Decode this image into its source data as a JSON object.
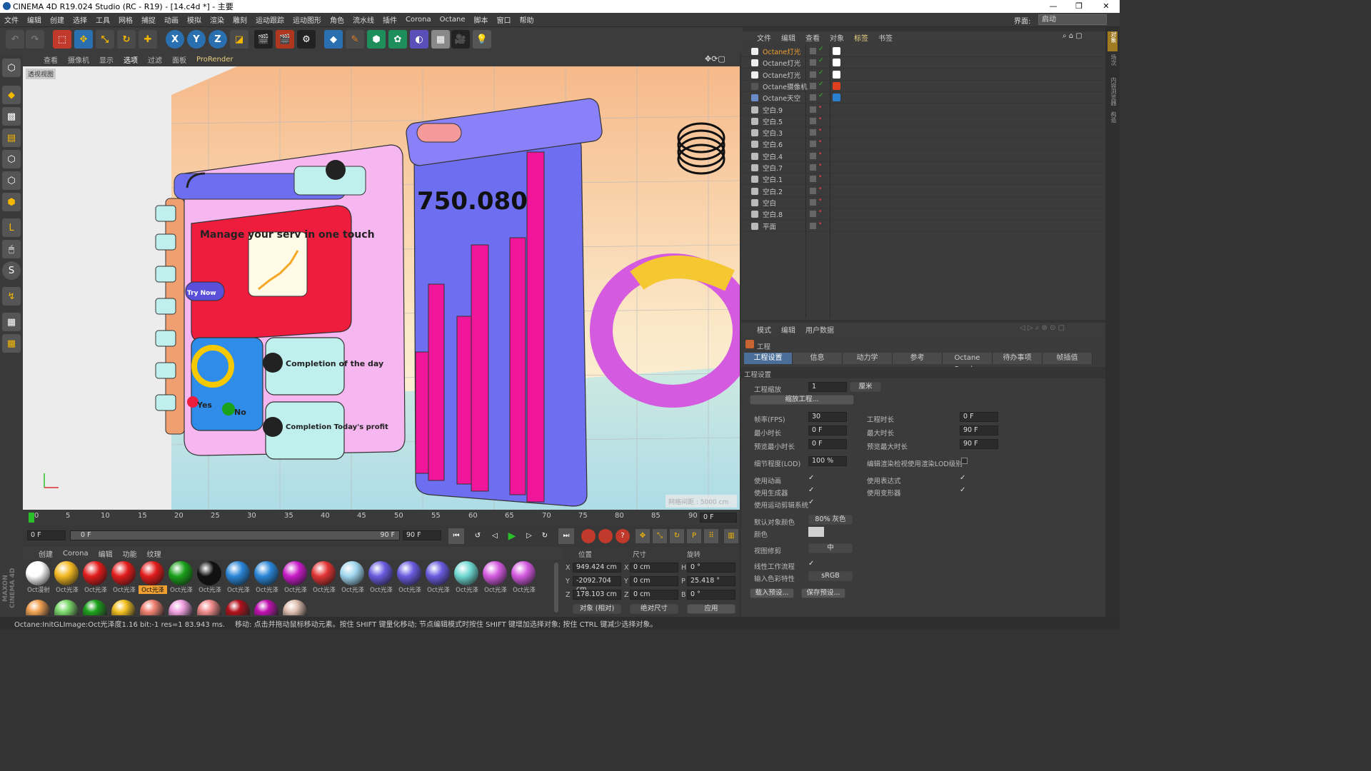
{
  "window": {
    "title": "CINEMA 4D R19.024 Studio (RC - R19) - [14.c4d *] - 主要",
    "min": "—",
    "max": "❐",
    "close": "✕"
  },
  "menu": [
    "文件",
    "编辑",
    "创建",
    "选择",
    "工具",
    "网格",
    "捕捉",
    "动画",
    "模拟",
    "渲染",
    "雕刻",
    "运动跟踪",
    "运动图形",
    "角色",
    "流水线",
    "插件",
    "Corona",
    "Octane",
    "脚本",
    "窗口",
    "帮助"
  ],
  "layout": {
    "label": "界面:",
    "value": "启动"
  },
  "viewport": {
    "menu": [
      "查看",
      "摄像机",
      "显示",
      "选项",
      "过滤",
      "面板",
      "ProRender"
    ],
    "camera_label": "透视视图",
    "grid_text": "网格间距 : 5000 cm",
    "scene_number": "750.080.",
    "card_title": "Manage your serv in one touch",
    "try_now": "Try Now",
    "completion1": "Completion of the day",
    "completion2": "Completion Today's profit",
    "yes": "Yes",
    "no": "No"
  },
  "timeline": {
    "ticks": [
      "0",
      "5",
      "10",
      "15",
      "20",
      "25",
      "30",
      "35",
      "40",
      "45",
      "50",
      "55",
      "60",
      "65",
      "70",
      "75",
      "80",
      "85",
      "90"
    ],
    "end": "0 F"
  },
  "transport": {
    "start": "0 F",
    "range_start": "0 F",
    "range_end": "90 F",
    "end": "90 F"
  },
  "materials": {
    "menu": [
      "创建",
      "Corona",
      "编辑",
      "功能",
      "纹理"
    ],
    "row1": [
      {
        "label": "Oct漫射",
        "color": "#ffffff"
      },
      {
        "label": "Oct光泽",
        "color": "#f2b820"
      },
      {
        "label": "Oct光泽",
        "color": "#e21c1c"
      },
      {
        "label": "Oct光泽",
        "color": "#e21c1c"
      },
      {
        "label": "Oct光泽",
        "color": "#e21c1c"
      },
      {
        "label": "Oct光泽",
        "color": "#1aa11a"
      },
      {
        "label": "Oct光泽",
        "color": "#111111"
      },
      {
        "label": "Oct光泽",
        "color": "#2a86d8"
      },
      {
        "label": "Oct光泽",
        "color": "#2a86d8"
      },
      {
        "label": "Oct光泽",
        "color": "#c81cc8"
      },
      {
        "label": "Oct光泽",
        "color": "#e23434"
      },
      {
        "label": "Oct光泽",
        "color": "#9fd6ee"
      },
      {
        "label": "Oct光泽",
        "color": "#6a5ce0"
      },
      {
        "label": "Oct光泽",
        "color": "#6a5ce0"
      },
      {
        "label": "Oct光泽",
        "color": "#6a5ce0"
      },
      {
        "label": "Oct光泽",
        "color": "#6ed8d2"
      },
      {
        "label": "Oct光泽",
        "color": "#d45ae0"
      },
      {
        "label": "Oct光泽",
        "color": "#d45ae0"
      }
    ],
    "row2": [
      {
        "color": "#f0a050"
      },
      {
        "color": "#7ad86a"
      },
      {
        "color": "#1aa11a"
      },
      {
        "color": "#f2c020"
      },
      {
        "color": "#f08070"
      },
      {
        "color": "#f0a0e0"
      },
      {
        "color": "#f08a8a"
      },
      {
        "color": "#b0101a"
      },
      {
        "color": "#c010b0"
      },
      {
        "color": "#e0c0b0"
      }
    ]
  },
  "coords": {
    "headers": [
      "位置",
      "尺寸",
      "旋转"
    ],
    "rows": [
      {
        "axis": "X",
        "pos": "949.424 cm",
        "size": "0 cm",
        "rl": "H",
        "rot": "0 °"
      },
      {
        "axis": "Y",
        "pos": "-2092.704 cm",
        "size": "0 cm",
        "rl": "P",
        "rot": "25.418 °"
      },
      {
        "axis": "Z",
        "pos": "178.103 cm",
        "size": "0 cm",
        "rl": "B",
        "rot": "0 °"
      }
    ],
    "mode": "对象 (相对)",
    "size_mode": "绝对尺寸",
    "apply": "应用"
  },
  "objects": {
    "menu": [
      "文件",
      "编辑",
      "查看",
      "对象",
      "标签",
      "书签"
    ],
    "items": [
      {
        "name": "Octane灯光",
        "highlight": true
      },
      {
        "name": "Octane灯光",
        "highlight": false
      },
      {
        "name": "Octane灯光",
        "highlight": false
      },
      {
        "name": "Octane摄像机",
        "highlight": false
      },
      {
        "name": "Octane天空",
        "highlight": false
      },
      {
        "name": "空白.9",
        "highlight": false
      },
      {
        "name": "空白.5",
        "highlight": false
      },
      {
        "name": "空白.3",
        "highlight": false
      },
      {
        "name": "空白.6",
        "highlight": false
      },
      {
        "name": "空白.4",
        "highlight": false
      },
      {
        "name": "空白.7",
        "highlight": false
      },
      {
        "name": "空白.1",
        "highlight": false
      },
      {
        "name": "空白.2",
        "highlight": false
      },
      {
        "name": "空白",
        "highlight": false
      },
      {
        "name": "空白.8",
        "highlight": false
      },
      {
        "name": "平面",
        "highlight": false
      }
    ]
  },
  "attributes": {
    "menu": [
      "模式",
      "编辑",
      "用户数据"
    ],
    "section": "工程",
    "tabs": [
      "工程设置",
      "信息",
      "动力学",
      "参考",
      "Octane Render",
      "待办事项",
      "帧插值"
    ],
    "group": "工程设置",
    "scale_label": "工程缩放",
    "scale_value": "1",
    "scale_unit": "厘米",
    "scale_button": "缩放工程...",
    "fps_label": "帧率(FPS)",
    "fps": "30",
    "duration_label": "工程时长",
    "duration": "0 F",
    "min_label": "最小时长",
    "min": "0 F",
    "max_label": "最大时长",
    "max": "90 F",
    "pmin_label": "预览最小时长",
    "pmin": "0 F",
    "pmax_label": "预览最大时长",
    "pmax": "90 F",
    "lod_label": "细节程度(LOD)",
    "lod": "100 %",
    "lod_render_label": "编辑渲染检视使用渲染LOD级别",
    "use_anim": "使用动画",
    "use_expr": "使用表达式",
    "use_gen": "使用生成器",
    "use_deform": "使用变形器",
    "use_motion": "使用运动剪辑系统",
    "def_color_label": "默认对象颜色",
    "def_color": "80% 灰色",
    "color_label": "颜色",
    "clip_label": "视图修剪",
    "clip": "中",
    "linear_label": "线性工作流程",
    "input_label": "输入色彩特性",
    "input": "sRGB",
    "load_preset": "载入预设...",
    "save_preset": "保存预设..."
  },
  "status": {
    "left": "Octane:InitGLImage:Oct光泽度1.16  bit:-1 res=1 83.943 ms.",
    "right": "移动: 点击并拖动鼠标移动元素。按住 SHIFT 键量化移动; 节点编辑模式时按住 SHIFT 键增加选择对象; 按住 CTRL 键减少选择对象。"
  },
  "strip": [
    "对象",
    "场次",
    "内容浏览器",
    "构造"
  ],
  "brand": "MAXON CINEMA 4D"
}
